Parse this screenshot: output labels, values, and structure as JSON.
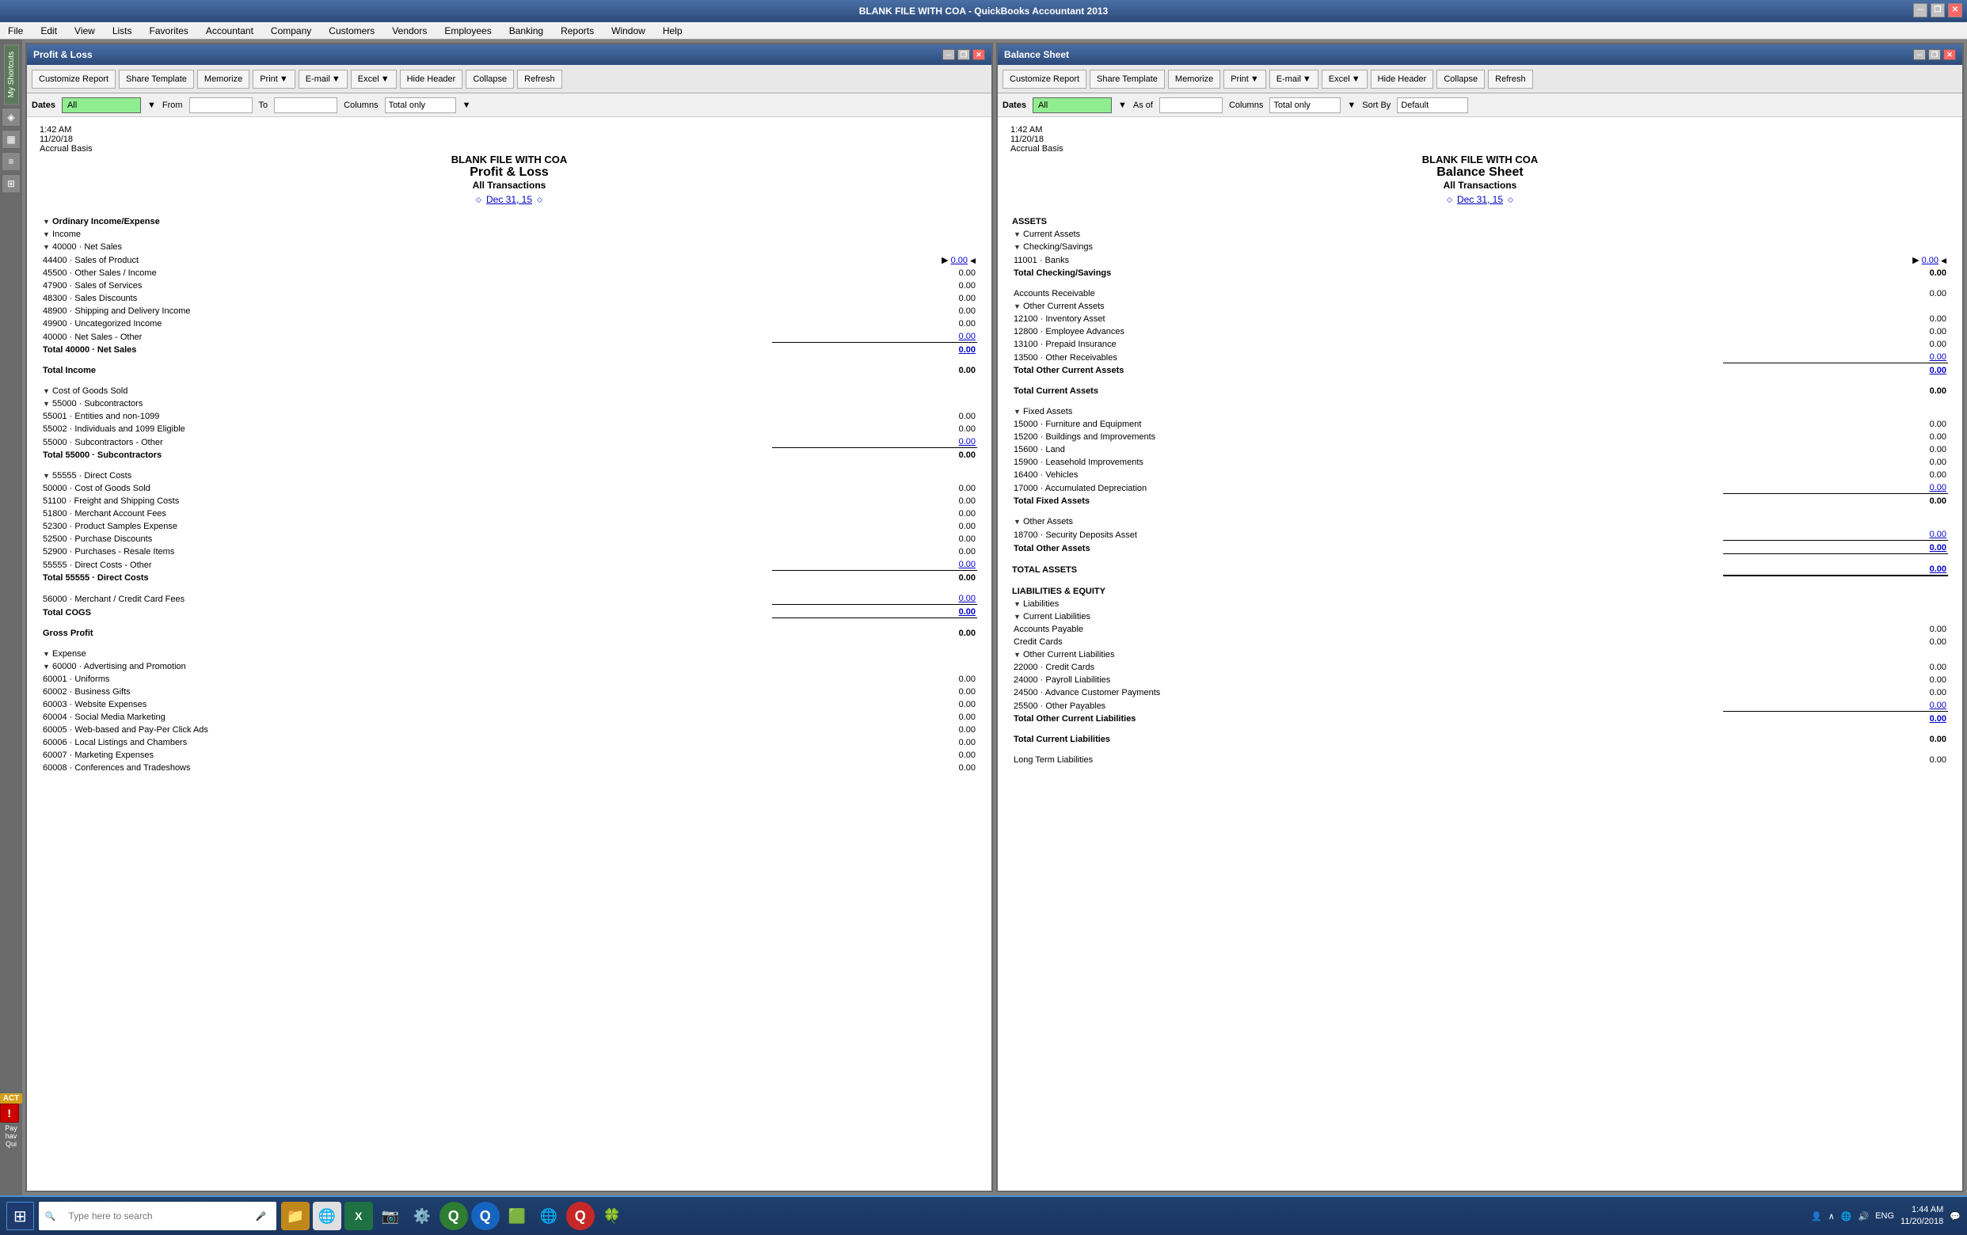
{
  "app": {
    "title": "BLANK FILE WITH COA - QuickBooks Accountant 2013",
    "title_controls": [
      "minimize",
      "restore",
      "close"
    ]
  },
  "menu": {
    "items": [
      "File",
      "Edit",
      "View",
      "Lists",
      "Favorites",
      "Accountant",
      "Company",
      "Customers",
      "Vendors",
      "Employees",
      "Banking",
      "Reports",
      "Window",
      "Help"
    ]
  },
  "profit_loss": {
    "window_title": "Profit & Loss",
    "toolbar": {
      "customize": "Customize Report",
      "share": "Share Template",
      "memorize": "Memorize",
      "print": "Print",
      "email": "E-mail",
      "excel": "Excel",
      "hide_header": "Hide Header",
      "collapse": "Collapse",
      "refresh": "Refresh"
    },
    "dates_bar": {
      "dates_label": "Dates",
      "dates_value": "All",
      "from_label": "From",
      "from_value": "",
      "to_label": "To",
      "to_value": "",
      "columns_label": "Columns",
      "columns_value": "Total only"
    },
    "header": {
      "company": "BLANK FILE WITH COA",
      "title": "Profit & Loss",
      "subtitle": "All Transactions",
      "time": "1:42 AM",
      "date": "11/20/18",
      "basis": "Accrual Basis",
      "report_date": "Dec 31, 15"
    },
    "sections": {
      "ordinary_income": "Ordinary Income/Expense",
      "income": "Income",
      "net_sales": "40000 · Net Sales",
      "line_items": [
        {
          "label": "44400 · Sales of Product",
          "amount": "0.00",
          "indent": 3,
          "has_arrow": true
        },
        {
          "label": "45500 · Other Sales / Income",
          "amount": "0.00",
          "indent": 3
        },
        {
          "label": "47900 · Sales of Services",
          "amount": "0.00",
          "indent": 3
        },
        {
          "label": "48300 · Sales Discounts",
          "amount": "0.00",
          "indent": 3
        },
        {
          "label": "48900 · Shipping and Delivery Income",
          "amount": "0.00",
          "indent": 3
        },
        {
          "label": "49900 · Uncategorized Income",
          "amount": "0.00",
          "indent": 3
        },
        {
          "label": "40000 · Net Sales - Other",
          "amount": "0.00",
          "indent": 3,
          "underline": true
        },
        {
          "label": "Total 40000 · Net Sales",
          "amount": "0.00",
          "indent": 2,
          "bold": true
        }
      ],
      "total_income": {
        "label": "Total Income",
        "amount": "0.00"
      },
      "cogs_section": "Cost of Goods Sold",
      "subcontractors": "55000 · Subcontractors",
      "sub_items": [
        {
          "label": "55001 · Entities and non-1099",
          "amount": "0.00",
          "indent": 3
        },
        {
          "label": "55002 · Individuals and 1099 Eligible",
          "amount": "0.00",
          "indent": 3
        },
        {
          "label": "55000 · Subcontractors - Other",
          "amount": "0.00",
          "indent": 3,
          "underline": true
        },
        {
          "label": "Total 55000 · Subcontractors",
          "amount": "0.00",
          "indent": 2,
          "bold": true
        }
      ],
      "direct_costs": "55555 · Direct Costs",
      "direct_items": [
        {
          "label": "50000 · Cost of Goods Sold",
          "amount": "0.00",
          "indent": 3
        },
        {
          "label": "51100 · Freight and Shipping Costs",
          "amount": "0.00",
          "indent": 3
        },
        {
          "label": "51800 · Merchant Account Fees",
          "amount": "0.00",
          "indent": 3
        },
        {
          "label": "52300 · Product Samples Expense",
          "amount": "0.00",
          "indent": 3
        },
        {
          "label": "52500 · Purchase Discounts",
          "amount": "0.00",
          "indent": 3
        },
        {
          "label": "52900 · Purchases - Resale Items",
          "amount": "0.00",
          "indent": 3
        },
        {
          "label": "55555 · Direct Costs - Other",
          "amount": "0.00",
          "indent": 3,
          "underline": true
        },
        {
          "label": "Total 55555 · Direct Costs",
          "amount": "0.00",
          "indent": 2,
          "bold": true
        }
      ],
      "merchant_fees": {
        "label": "56000 · Merchant / Credit Card Fees",
        "amount": "0.00",
        "indent": 2,
        "underline": true
      },
      "total_cogs": {
        "label": "Total COGS",
        "amount": "0.00",
        "underline": true
      },
      "gross_profit": {
        "label": "Gross Profit",
        "amount": "0.00"
      },
      "expense": "Expense",
      "adv_promo": "60000 · Advertising and Promotion",
      "adv_items": [
        {
          "label": "60001 · Uniforms",
          "amount": "0.00",
          "indent": 3
        },
        {
          "label": "60002 · Business Gifts",
          "amount": "0.00",
          "indent": 3
        },
        {
          "label": "60003 · Website Expenses",
          "amount": "0.00",
          "indent": 3
        },
        {
          "label": "60004 · Social Media Marketing",
          "amount": "0.00",
          "indent": 3
        },
        {
          "label": "60005 · Web-based and Pay-Per Click Ads",
          "amount": "0.00",
          "indent": 3
        },
        {
          "label": "60006 · Local Listings and Chambers",
          "amount": "0.00",
          "indent": 3
        },
        {
          "label": "60007 · Marketing Expenses",
          "amount": "0.00",
          "indent": 3
        },
        {
          "label": "60008 · Conferences and Tradeshows",
          "amount": "0.00",
          "indent": 3
        }
      ]
    }
  },
  "balance_sheet": {
    "window_title": "Balance Sheet",
    "toolbar": {
      "customize": "Customize Report",
      "share": "Share Template",
      "memorize": "Memorize",
      "print": "Print",
      "email": "E-mail",
      "excel": "Excel",
      "hide_header": "Hide Header",
      "collapse": "Collapse",
      "refresh": "Refresh"
    },
    "dates_bar": {
      "dates_label": "Dates",
      "dates_value": "All",
      "as_of_label": "As of",
      "as_of_value": "",
      "columns_label": "Columns",
      "columns_value": "Total only",
      "sort_label": "Sort By",
      "sort_value": "Default"
    },
    "header": {
      "company": "BLANK FILE WITH COA",
      "title": "Balance Sheet",
      "subtitle": "All Transactions",
      "time": "1:42 AM",
      "date": "11/20/18",
      "basis": "Accrual Basis",
      "report_date": "Dec 31, 15"
    },
    "assets": {
      "header": "ASSETS",
      "current_assets": "Current Assets",
      "checking": "Checking/Savings",
      "checking_items": [
        {
          "label": "11001 · Banks",
          "amount": "0.00",
          "indent": 3,
          "has_arrow": true,
          "underline": true
        }
      ],
      "total_checking": {
        "label": "Total Checking/Savings",
        "amount": "0.00"
      },
      "accounts_receivable": {
        "label": "Accounts Receivable",
        "amount": "0.00"
      },
      "other_current": "Other Current Assets",
      "other_current_items": [
        {
          "label": "12100 · Inventory Asset",
          "amount": "0.00",
          "indent": 3
        },
        {
          "label": "12800 · Employee Advances",
          "amount": "0.00",
          "indent": 3
        },
        {
          "label": "13100 · Prepaid Insurance",
          "amount": "0.00",
          "indent": 3
        },
        {
          "label": "13500 · Other Receivables",
          "amount": "0.00",
          "indent": 3,
          "underline": true
        },
        {
          "label": "Total Other Current Assets",
          "amount": "0.00",
          "indent": 2,
          "bold": true
        }
      ],
      "total_current": {
        "label": "Total Current Assets",
        "amount": "0.00"
      },
      "fixed_assets": "Fixed Assets",
      "fixed_items": [
        {
          "label": "15000 · Furniture and Equipment",
          "amount": "0.00",
          "indent": 3
        },
        {
          "label": "15200 · Buildings and Improvements",
          "amount": "0.00",
          "indent": 3
        },
        {
          "label": "15600 · Land",
          "amount": "0.00",
          "indent": 3
        },
        {
          "label": "15900 · Leasehold Improvements",
          "amount": "0.00",
          "indent": 3
        },
        {
          "label": "16400 · Vehicles",
          "amount": "0.00",
          "indent": 3
        },
        {
          "label": "17000 · Accumulated Depreciation",
          "amount": "0.00",
          "indent": 3,
          "underline": true
        },
        {
          "label": "Total Fixed Assets",
          "amount": "0.00",
          "indent": 2,
          "bold": true
        }
      ],
      "other_assets": "Other Assets",
      "other_assets_items": [
        {
          "label": "18700 · Security Deposits Asset",
          "amount": "0.00",
          "indent": 3,
          "underline": true
        },
        {
          "label": "Total Other Assets",
          "amount": "0.00",
          "indent": 2,
          "bold": true,
          "underline": true
        }
      ],
      "total_assets": {
        "label": "TOTAL ASSETS",
        "amount": "0.00",
        "bold": true,
        "double_underline": true
      }
    },
    "liabilities": {
      "header": "LIABILITIES & EQUITY",
      "liabilities": "Liabilities",
      "current_liabilities": "Current Liabilities",
      "current_items": [
        {
          "label": "Accounts Payable",
          "amount": "0.00",
          "indent": 3
        },
        {
          "label": "Credit Cards",
          "amount": "0.00",
          "indent": 3
        }
      ],
      "other_current_liab": "Other Current Liabilities",
      "other_current_liab_items": [
        {
          "label": "22000 · Credit Cards",
          "amount": "0.00",
          "indent": 3
        },
        {
          "label": "24000 · Payroll Liabilities",
          "amount": "0.00",
          "indent": 3
        },
        {
          "label": "24500 · Advance Customer Payments",
          "amount": "0.00",
          "indent": 3
        },
        {
          "label": "25500 · Other Payables",
          "amount": "0.00",
          "indent": 3,
          "underline": true
        },
        {
          "label": "Total Other Current Liabilities",
          "amount": "0.00",
          "indent": 2,
          "bold": true
        }
      ],
      "total_current_liab": {
        "label": "Total Current Liabilities",
        "amount": "0.00"
      },
      "long_term": {
        "label": "Long Term Liabilities",
        "amount": "0.00"
      }
    }
  },
  "taskbar": {
    "search_placeholder": "Type here to search",
    "time": "1:44 AM",
    "date": "11/20/2018"
  }
}
